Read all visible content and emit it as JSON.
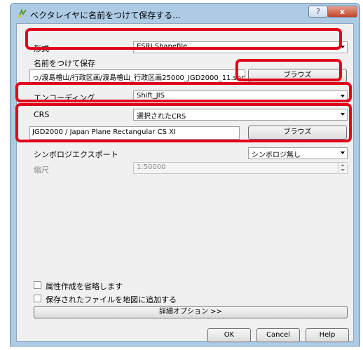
{
  "window": {
    "title": "ベクタレイヤに名前をつけて保存する...",
    "help_label": "?",
    "close_label": "x"
  },
  "format": {
    "label": "形式",
    "value": "ESRI Shapefile"
  },
  "save_as": {
    "label": "名前をつけて保存",
    "value": "っ/渡島檜山/行政区画/渡島檜山_行政区画25000_JGD2000_11.shp",
    "browse_label": "ブラウズ"
  },
  "encoding": {
    "label": "エンコーディング",
    "value": "Shift_JIS"
  },
  "crs": {
    "label": "CRS",
    "mode_value": "選択されたCRS",
    "value": "JGD2000 / Japan Plane Rectangular CS XI",
    "browse_label": "ブラウズ"
  },
  "symbology": {
    "label": "シンボロジエクスポート",
    "value": "シンボロジ無し"
  },
  "scale": {
    "label": "縮尺",
    "value": "1:50000"
  },
  "options": {
    "skip_attr": "属性作成を省略します",
    "add_to_map": "保存されたファイルを地図に追加する",
    "advanced": "詳細オプション >>"
  },
  "buttons": {
    "ok": "OK",
    "cancel": "Cancel",
    "help": "Help"
  },
  "colors": {
    "highlight": "#e0001b",
    "frame": "#aecbe6",
    "client": "#f0f0f0"
  }
}
